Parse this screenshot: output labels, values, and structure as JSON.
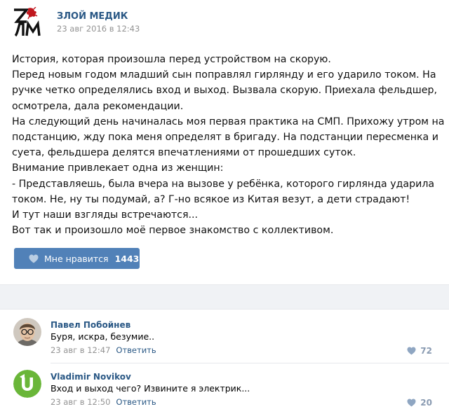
{
  "post": {
    "author": "ЗЛОЙ МЕДИК",
    "date": "23 авг 2016 в 12:43",
    "lines": [
      "История, которая произошла перед устройством на скорую.",
      "Перед новым годом младший сын поправлял гирлянду и его ударило током. На",
      "ручке четко определялись вход и выход. Вызвала скорую. Приехала фельдшер,",
      "осмотрела, дала рекомендации.",
      "На следующий день начиналась моя первая практика на СМП. Прихожу утром на",
      "подстанцию, жду пока меня определят в бригаду. На подстанции пересменка и",
      "суета, фельдшера делятся впечатлениями от прошедших суток.",
      "Внимание привлекает одна из женщин:",
      "- Представляешь, была вчера на вызове у ребёнка, которого гирлянда ударила",
      "током. Не, ну ты подумай, а? Г-но всякое из Китая везут, а дети страдают!",
      "И тут наши взгляды встречаются...",
      "Вот так и произошло моё первое знакомство с коллективом."
    ],
    "like_label": "Мне нравится",
    "like_count": "1443"
  },
  "comments": [
    {
      "name": "Павел Побойнев",
      "text": "Буря, искра, безумие..",
      "date": "23 авг в 12:47",
      "reply": "Ответить",
      "likes": "72"
    },
    {
      "name": "Vladimir Novikov",
      "text": "Вход и выход чего? Извините я электрик...",
      "date": "23 авг в 12:50",
      "reply": "Ответить",
      "likes": "20"
    }
  ],
  "colors": {
    "link": "#2a5885",
    "button": "#5181b8",
    "muted": "#939393",
    "logo_red": "#c0171e",
    "utorrent_green": "#6ab639"
  },
  "icons": {
    "logo": "zlm-logo",
    "like": "heart-icon",
    "avatar_1": "user-photo-avatar",
    "avatar_2": "utorrent-logo-avatar"
  }
}
